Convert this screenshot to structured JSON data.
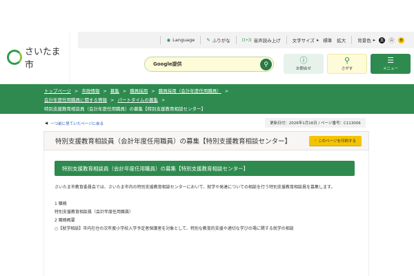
{
  "header": {
    "logo_text": "さいたま市",
    "utility": {
      "language": "Language",
      "furigana": "ふりがな",
      "speech": "音声読み上げ",
      "text_size_label": "文字サイズ",
      "text_size_standard": "標準",
      "text_size_large": "拡大",
      "bg_label": "背景色",
      "bg_black": "黒",
      "bg_white": "白",
      "bg_yellow": "黄"
    },
    "search_placeholder": "Google提供",
    "buttons": {
      "contact": "お問合せ",
      "find": "さがす",
      "menu": "メニュー"
    }
  },
  "breadcrumb": [
    "トップページ",
    "市政情報",
    "募集",
    "職員採用",
    "職員採用（会計年度任用職員）",
    "会計年度任用職員に関する情報",
    "パートタイムの募集"
  ],
  "breadcrumb_current": "特別支援教育相談員（会計年度任用職員）の募集【特別支援教育相談センター】",
  "back_link": "一つ前に見ていたページに戻る",
  "meta": "更新日付：2026年1月16日 / ページ番号：C113006",
  "page_title": "特別支援教育相談員（会計年度任用職員）の募集【特別支援教育相談センター】",
  "print_button": "このページを印刷する",
  "section_heading": "特別支援教育相談員（会計年度任用職員）の募集【特別支援教育相談センター】",
  "body": {
    "intro": "さいたま市教育委員会では、さいたま市内の特別支援教育相談センターにおいて、就学や発達についての相談を行う特別支援教育相談員を募集します。",
    "item1_title": "1 職務",
    "item1_text": "特別支援教育相談員（会計年度任用職員）",
    "item2_title": "2 職務概要",
    "item2_text": "○【就学相談】市内在住の次年度小学校入学予定者保護者を対象として、特別な教育的支援や適切な学びの場に関する就学の相談"
  },
  "colors": {
    "green": "#2e8a4e",
    "yellow": "#f5c400"
  }
}
